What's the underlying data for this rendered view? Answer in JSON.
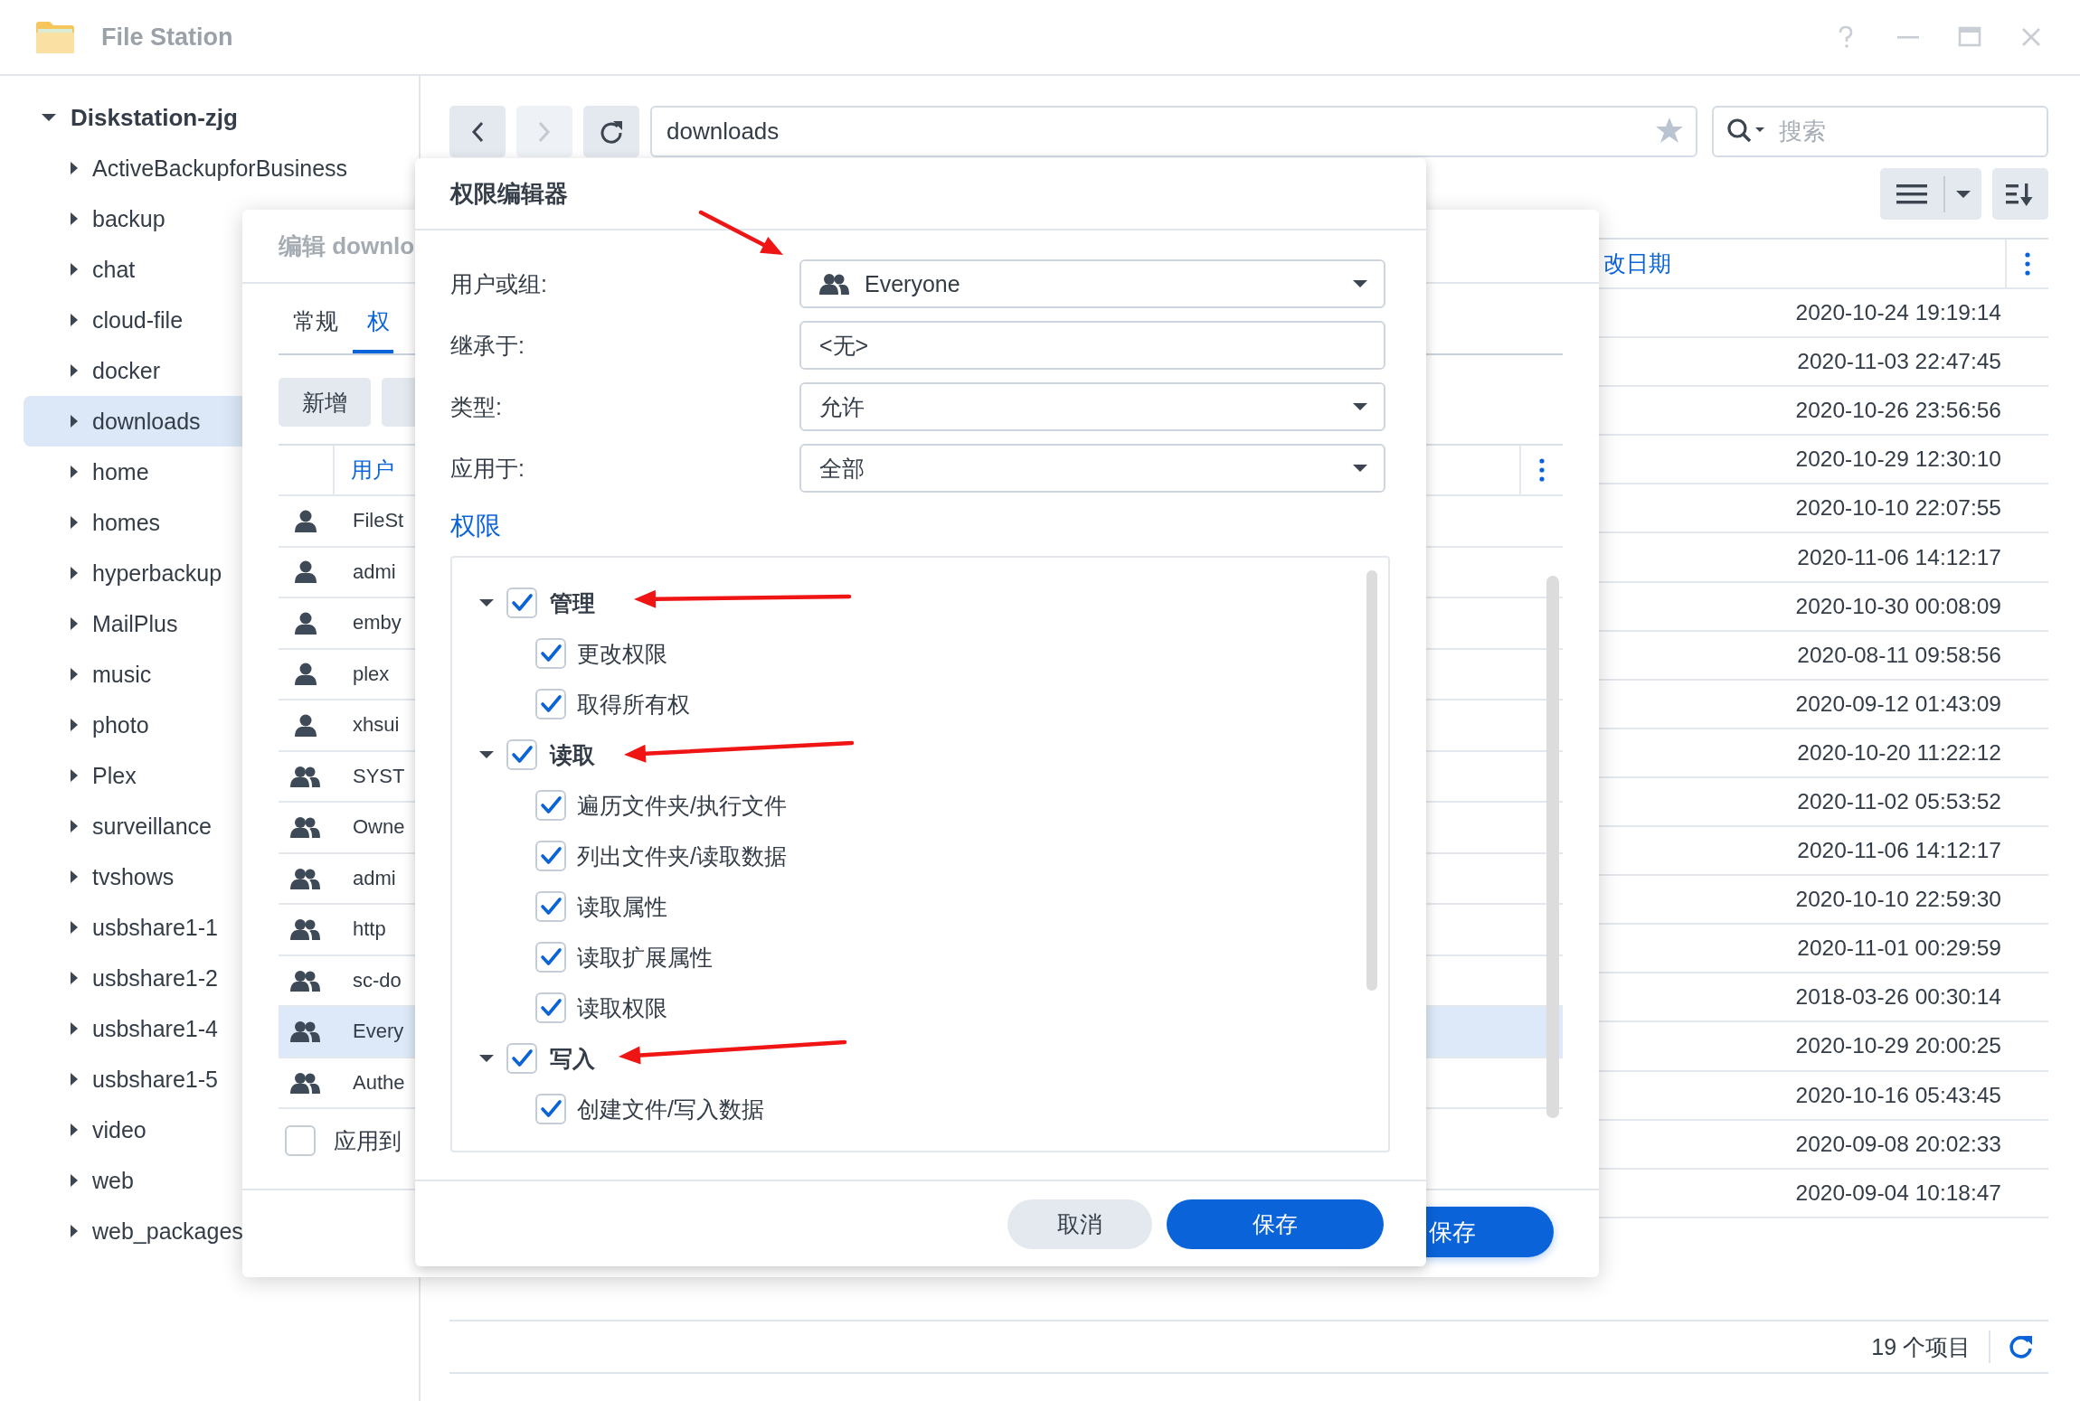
{
  "window": {
    "title": "File Station"
  },
  "sidebar": {
    "root": {
      "label": "Diskstation-zjg",
      "expanded": true,
      "children": [
        {
          "label": "ActiveBackupforBusiness",
          "selected": false,
          "expanded": false
        },
        {
          "label": "backup",
          "selected": false,
          "expanded": false
        },
        {
          "label": "chat",
          "selected": false,
          "expanded": false
        },
        {
          "label": "cloud-file",
          "selected": false,
          "expanded": false
        },
        {
          "label": "docker",
          "selected": false,
          "expanded": false
        },
        {
          "label": "downloads",
          "selected": true,
          "expanded": false
        },
        {
          "label": "home",
          "selected": false,
          "expanded": false
        },
        {
          "label": "homes",
          "selected": false,
          "expanded": false
        },
        {
          "label": "hyperbackup",
          "selected": false,
          "expanded": false
        },
        {
          "label": "MailPlus",
          "selected": false,
          "expanded": false
        },
        {
          "label": "music",
          "selected": false,
          "expanded": false
        },
        {
          "label": "photo",
          "selected": false,
          "expanded": false
        },
        {
          "label": "Plex",
          "selected": false,
          "expanded": false
        },
        {
          "label": "surveillance",
          "selected": false,
          "expanded": false
        },
        {
          "label": "tvshows",
          "selected": false,
          "expanded": false
        },
        {
          "label": "usbshare1-1",
          "selected": false,
          "expanded": false
        },
        {
          "label": "usbshare1-2",
          "selected": false,
          "expanded": false
        },
        {
          "label": "usbshare1-4",
          "selected": false,
          "expanded": false
        },
        {
          "label": "usbshare1-5",
          "selected": false,
          "expanded": false
        },
        {
          "label": "video",
          "selected": false,
          "expanded": false
        },
        {
          "label": "web",
          "selected": false,
          "expanded": false
        },
        {
          "label": "web_packages",
          "selected": false,
          "expanded": false
        }
      ]
    }
  },
  "toolbar": {
    "navigation": [
      {
        "kind": "back",
        "disabled": false
      },
      {
        "kind": "forward",
        "disabled": true
      },
      {
        "kind": "refresh",
        "disabled": false
      }
    ],
    "path": "downloads",
    "search": {
      "placeholder": "搜索"
    }
  },
  "file_list": {
    "columns": [
      "改日期"
    ],
    "rows": [
      {
        "modified": "2020-10-24 19:19:14"
      },
      {
        "modified": "2020-11-03 22:47:45"
      },
      {
        "modified": "2020-10-26 23:56:56"
      },
      {
        "modified": "2020-10-29 12:30:10"
      },
      {
        "modified": "2020-10-10 22:07:55"
      },
      {
        "modified": "2020-11-06 14:12:17"
      },
      {
        "modified": "2020-10-30 00:08:09"
      },
      {
        "modified": "2020-08-11 09:58:56"
      },
      {
        "modified": "2020-09-12 01:43:09"
      },
      {
        "modified": "2020-10-20 11:22:12"
      },
      {
        "modified": "2020-11-02 05:53:52"
      },
      {
        "modified": "2020-11-06 14:12:17"
      },
      {
        "modified": "2020-10-10 22:59:30"
      },
      {
        "modified": "2020-11-01 00:29:59"
      },
      {
        "modified": "2018-03-26 00:30:14"
      },
      {
        "modified": "2020-10-29 20:00:25"
      },
      {
        "modified": "2020-10-16 05:43:45"
      },
      {
        "modified": "2020-09-08 20:02:33"
      },
      {
        "modified": "2020-09-04 10:18:47"
      }
    ]
  },
  "status_bar": {
    "count": "19 个项目"
  },
  "share_dialog": {
    "title": "编辑 downlo",
    "tabs": [
      {
        "label": "常规",
        "selected": false
      },
      {
        "label": "权",
        "selected": true
      }
    ],
    "buttons": [
      "新增"
    ],
    "columns": [
      "用户"
    ],
    "entries": [
      {
        "kind": "user",
        "name": "FileSt",
        "selected": false
      },
      {
        "kind": "user",
        "name": "admi",
        "selected": false
      },
      {
        "kind": "user",
        "name": "emby",
        "selected": false
      },
      {
        "kind": "user",
        "name": "plex",
        "selected": false
      },
      {
        "kind": "user",
        "name": "xhsui",
        "selected": false
      },
      {
        "kind": "group",
        "name": "SYST",
        "selected": false
      },
      {
        "kind": "group",
        "name": "Owne",
        "selected": false
      },
      {
        "kind": "group",
        "name": "admi",
        "selected": false
      },
      {
        "kind": "group",
        "name": "http",
        "selected": false
      },
      {
        "kind": "group",
        "name": "sc-do",
        "selected": false
      },
      {
        "kind": "group",
        "name": "Every",
        "selected": true
      },
      {
        "kind": "group",
        "name": "Authe",
        "selected": false
      }
    ],
    "apply_option": {
      "label": "应用到",
      "checked": false
    },
    "save": "保存"
  },
  "permission_editor": {
    "title": "权限编辑器",
    "fields": [
      {
        "kind": "group-select",
        "label": "用户或组:",
        "value": "Everyone"
      },
      {
        "kind": "text",
        "label": "继承于:",
        "value": "<无>"
      },
      {
        "kind": "select",
        "label": "类型:",
        "value": "允许"
      },
      {
        "kind": "select",
        "label": "应用于:",
        "value": "全部"
      }
    ],
    "section": "权限",
    "permissions": [
      {
        "label": "管理",
        "checked": true,
        "expanded": true,
        "children": [
          {
            "label": "更改权限",
            "checked": true
          },
          {
            "label": "取得所有权",
            "checked": true
          }
        ]
      },
      {
        "label": "读取",
        "checked": true,
        "expanded": true,
        "children": [
          {
            "label": "遍历文件夹/执行文件",
            "checked": true
          },
          {
            "label": "列出文件夹/读取数据",
            "checked": true
          },
          {
            "label": "读取属性",
            "checked": true
          },
          {
            "label": "读取扩展属性",
            "checked": true
          },
          {
            "label": "读取权限",
            "checked": true
          }
        ]
      },
      {
        "label": "写入",
        "checked": true,
        "expanded": true,
        "children": [
          {
            "label": "创建文件/写入数据",
            "checked": true
          }
        ]
      }
    ],
    "buttons": [
      {
        "kind": "secondary",
        "label": "取消"
      },
      {
        "kind": "primary",
        "label": "保存"
      }
    ]
  }
}
